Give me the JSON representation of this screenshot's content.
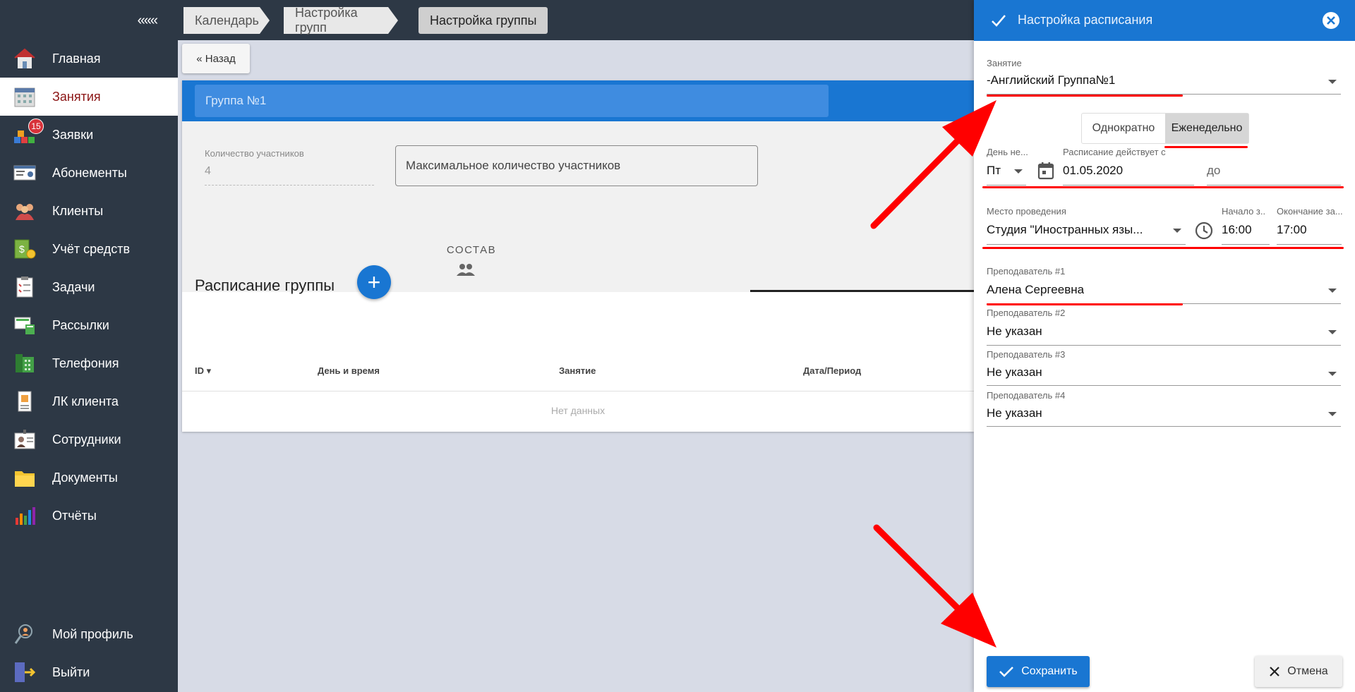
{
  "sidebar": {
    "collapse_label": "«««",
    "items": [
      {
        "label": "Главная",
        "icon": "home-icon"
      },
      {
        "label": "Занятия",
        "icon": "calendar-icon",
        "active": true
      },
      {
        "label": "Заявки",
        "icon": "requests-icon",
        "badge": "15"
      },
      {
        "label": "Абонементы",
        "icon": "subscription-card-icon"
      },
      {
        "label": "Клиенты",
        "icon": "clients-icon"
      },
      {
        "label": "Учёт средств",
        "icon": "money-icon"
      },
      {
        "label": "Задачи",
        "icon": "tasks-icon"
      },
      {
        "label": "Рассылки",
        "icon": "mailing-icon"
      },
      {
        "label": "Телефония",
        "icon": "phone-icon"
      },
      {
        "label": "ЛК клиента",
        "icon": "client-account-icon"
      },
      {
        "label": "Сотрудники",
        "icon": "staff-icon"
      },
      {
        "label": "Документы",
        "icon": "documents-icon"
      },
      {
        "label": "Отчёты",
        "icon": "reports-icon"
      }
    ],
    "bottom_items": [
      {
        "label": "Мой профиль",
        "icon": "profile-icon"
      },
      {
        "label": "Выйти",
        "icon": "logout-icon"
      }
    ]
  },
  "breadcrumbs": [
    "Календарь",
    "Настройка групп",
    "Настройка группы"
  ],
  "back_label": "« Назад",
  "group": {
    "name": "Группа №1",
    "count_label": "Количество участников",
    "count_value": "4",
    "max_placeholder": "Максимальное количество участников",
    "tab_label": "СОСТАВ"
  },
  "schedule": {
    "title": "Расписание группы",
    "add_label": "+",
    "columns": [
      "ID",
      "День и время",
      "Занятие",
      "Дата/Период"
    ],
    "empty_text": "Нет данных"
  },
  "panel": {
    "title": "Настройка расписания",
    "lesson_label": "Занятие",
    "lesson_value": "-Английский Группа№1",
    "mode_once": "Однократно",
    "mode_weekly": "Еженедельно",
    "mode_selected": "weekly",
    "day_label": "День не...",
    "day_value": "Пт",
    "from_label": "Расписание действует с",
    "from_value": "01.05.2020",
    "to_placeholder": "до",
    "place_label": "Место проведения",
    "place_value": "Студия \"Иностранных язы...",
    "start_label": "Начало з...",
    "start_value": "16:00",
    "end_label": "Окончание за...",
    "end_value": "17:00",
    "teachers": [
      {
        "label": "Преподаватель #1",
        "value": "Алена Сергеевна"
      },
      {
        "label": "Преподаватель #2",
        "value": "Не указан"
      },
      {
        "label": "Преподаватель #3",
        "value": "Не указан"
      },
      {
        "label": "Преподаватель #4",
        "value": "Не указан"
      }
    ],
    "save_label": "Сохранить",
    "cancel_label": "Отмена"
  },
  "colors": {
    "sidebar_bg": "#2d3845",
    "primary": "#1976d2",
    "annotation_red": "#ff0000"
  }
}
